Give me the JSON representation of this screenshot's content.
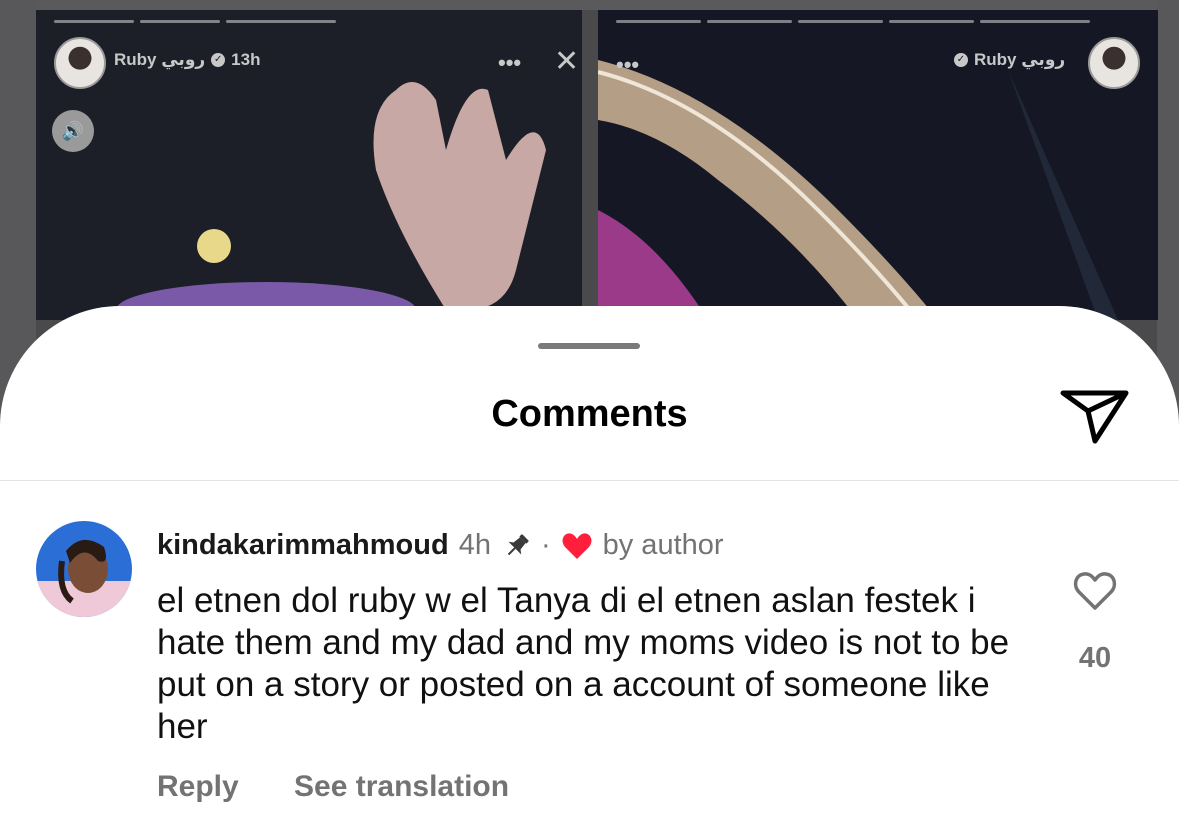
{
  "stories": {
    "left": {
      "user": "Ruby روبي",
      "time": "13h",
      "more": "•••",
      "close": "✕",
      "sound": "🔊"
    },
    "right": {
      "user": "Ruby روبي",
      "more": "•••"
    }
  },
  "sheet": {
    "title": "Comments"
  },
  "comment": {
    "username": "kindakarimmahmoud",
    "time": "4h",
    "dot": "·",
    "author_liked": "by author",
    "text": "el etnen dol ruby w el Tanya di el etnen aslan festek i hate them and my dad and my moms video is not to be put on a story or posted on a account of someone like her",
    "likes": "40",
    "reply_label": "Reply",
    "translate_label": "See translation"
  },
  "colors": {
    "accent_heart": "#ff1f3d",
    "muted": "#737373"
  }
}
